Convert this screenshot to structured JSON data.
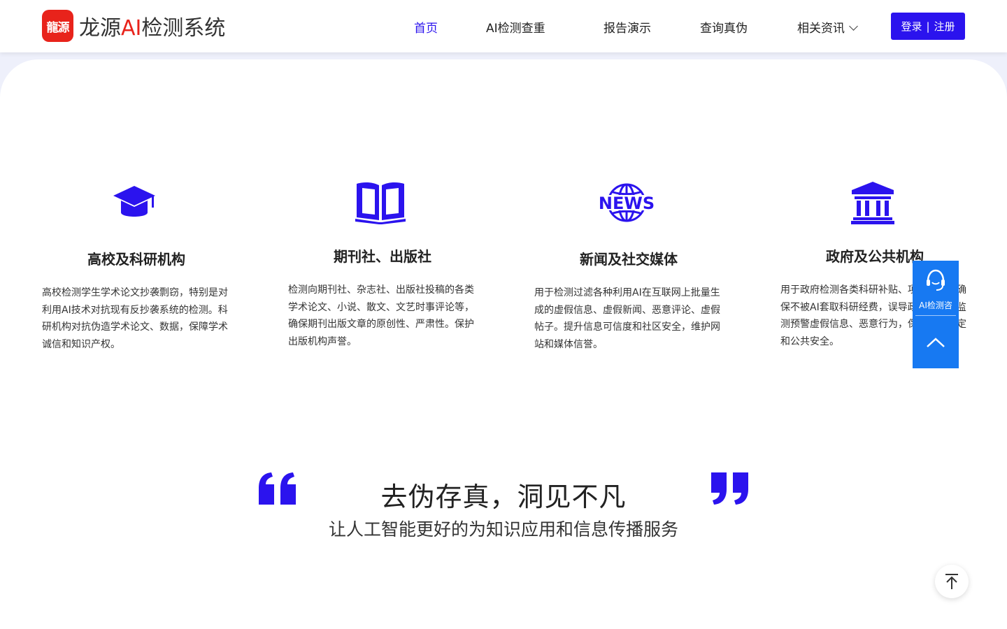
{
  "header": {
    "logo_mark": "龍源",
    "logo_text_pre": "龙源",
    "logo_text_ai": "AI",
    "logo_text_post": "检测系统",
    "nav": [
      {
        "label": "首页"
      },
      {
        "label": "AI检测查重"
      },
      {
        "label": "报告演示"
      },
      {
        "label": "查询真伪"
      },
      {
        "label": "相关资讯"
      }
    ],
    "login": "登录",
    "login_sep": "|",
    "register": "注册"
  },
  "cards": [
    {
      "icon": "graduation-cap-icon",
      "title": "高校及科研机构",
      "desc": "高校检测学生学术论文抄袭剽窃，特别是对利用AI技术对抗现有反抄袭系统的检测。科研机构对抗伪造学术论文、数据，保障学术诚信和知识产权。"
    },
    {
      "icon": "open-book-icon",
      "title": "期刊社、出版社",
      "desc": "检测向期刊社、杂志社、出版社投稿的各类学术论文、小说、散文、文艺时事评论等，确保期刊出版文章的原创性、严肃性。保护出版机构声誉。"
    },
    {
      "icon": "news-globe-icon",
      "title": "新闻及社交媒体",
      "desc": "用于检测过滤各种利用AI在互联网上批量生成的虚假信息、虚假新闻、恶意评论、虚假帖子。提升信息可信度和社区安全，维护网站和媒体信誉。"
    },
    {
      "icon": "government-building-icon",
      "title": "政府及公共机构",
      "desc": "用于政府检测各类科研补贴、项目申请，确保不被AI套取科研经费，误导政府决策。监测预警虚假信息、恶意行为，保障社会稳定和公共安全。"
    }
  ],
  "news_icon_text": "NEWS",
  "slogan": "去伪存真，洞见不凡",
  "sub_slogan": "让人工智能更好的为知识应用和信息传播服务",
  "float": {
    "consult_label": "AI检测咨"
  },
  "colors": {
    "accent": "#2b13ee",
    "brand_red": "#e8231b",
    "float_blue": "#1779f2"
  }
}
